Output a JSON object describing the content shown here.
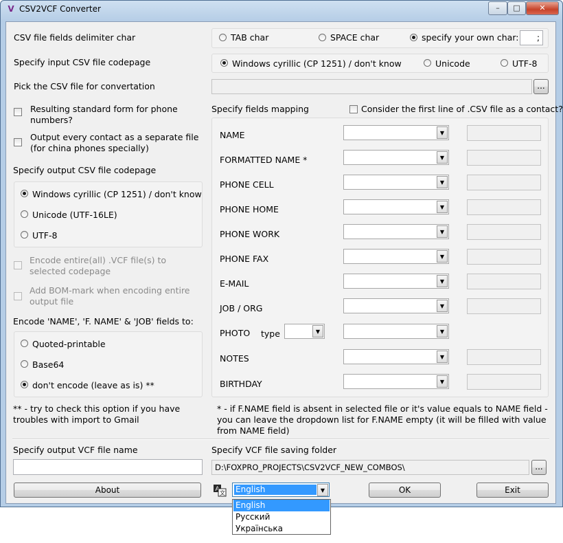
{
  "window": {
    "title": "CSV2VCF Converter",
    "app_icon": "V",
    "minimize": "–",
    "maximize": "□",
    "close": "✕"
  },
  "delimiter": {
    "label": "CSV file fields delimiter char",
    "options": [
      "TAB char",
      "SPACE char",
      "specify your own char:"
    ],
    "selected": 2,
    "own_char_value": ";"
  },
  "input_codepage": {
    "label": "Specify input CSV file codepage",
    "options": [
      "Windows cyrillic (CP 1251) / don't know",
      "Unicode",
      "UTF-8"
    ],
    "selected": 0
  },
  "pick_file": {
    "label": "Pick the CSV file for convertation",
    "value": "",
    "browse_label": "..."
  },
  "phone_form": {
    "label": "Resulting standard form for phone numbers?",
    "checked": false
  },
  "separate_file": {
    "label": "Output every contact as a separate file (for china phones specially)",
    "checked": false
  },
  "output_codepage": {
    "label": "Specify output CSV file codepage",
    "options": [
      "Windows cyrillic (CP 1251) / don't know",
      "Unicode (UTF-16LE)",
      "UTF-8"
    ],
    "selected": 0
  },
  "encode_entire": {
    "label": "Encode entire(all) .VCF file(s) to selected codepage",
    "checked": false,
    "disabled": true
  },
  "bom_mark": {
    "label": "Add BOM-mark when encoding entire output file",
    "checked": false,
    "disabled": true
  },
  "encode_fields": {
    "label": "Encode 'NAME', 'F. NAME' & 'JOB' fields to:",
    "options": [
      "Quoted-printable",
      "Base64",
      "don't encode (leave as is) **"
    ],
    "selected": 2
  },
  "gmail_note": "** - try to check this option if you have troubles with import to Gmail",
  "mapping": {
    "label": "Specify fields mapping",
    "first_line_label": "Consider the first line of .CSV file as a contact?",
    "first_line_checked": false,
    "fields": [
      "NAME",
      "FORMATTED NAME *",
      "PHONE CELL",
      "PHONE HOME",
      "PHONE WORK",
      "PHONE FAX",
      "E-MAIL",
      "JOB / ORG",
      "PHOTO",
      "NOTES",
      "BIRTHDAY"
    ],
    "photo_type_label": "type"
  },
  "fname_note": "* - if F.NAME field is absent in selected file or it's value equals to NAME field - you can leave the dropdown list for F.NAME empty (it will be filled with value from NAME field)",
  "output_name": {
    "label": "Specify output VCF file name",
    "value": ""
  },
  "saving_folder": {
    "label": "Specify VCF file saving folder",
    "value": "D:\\FOXPRO_PROJECTS\\CSV2VCF_NEW_COMBOS\\",
    "browse_label": "..."
  },
  "buttons": {
    "about": "About",
    "ok": "OK",
    "exit": "Exit"
  },
  "language": {
    "selected": "English",
    "options": [
      "English",
      "Русский",
      "Українська"
    ],
    "icon": "language-icon"
  }
}
